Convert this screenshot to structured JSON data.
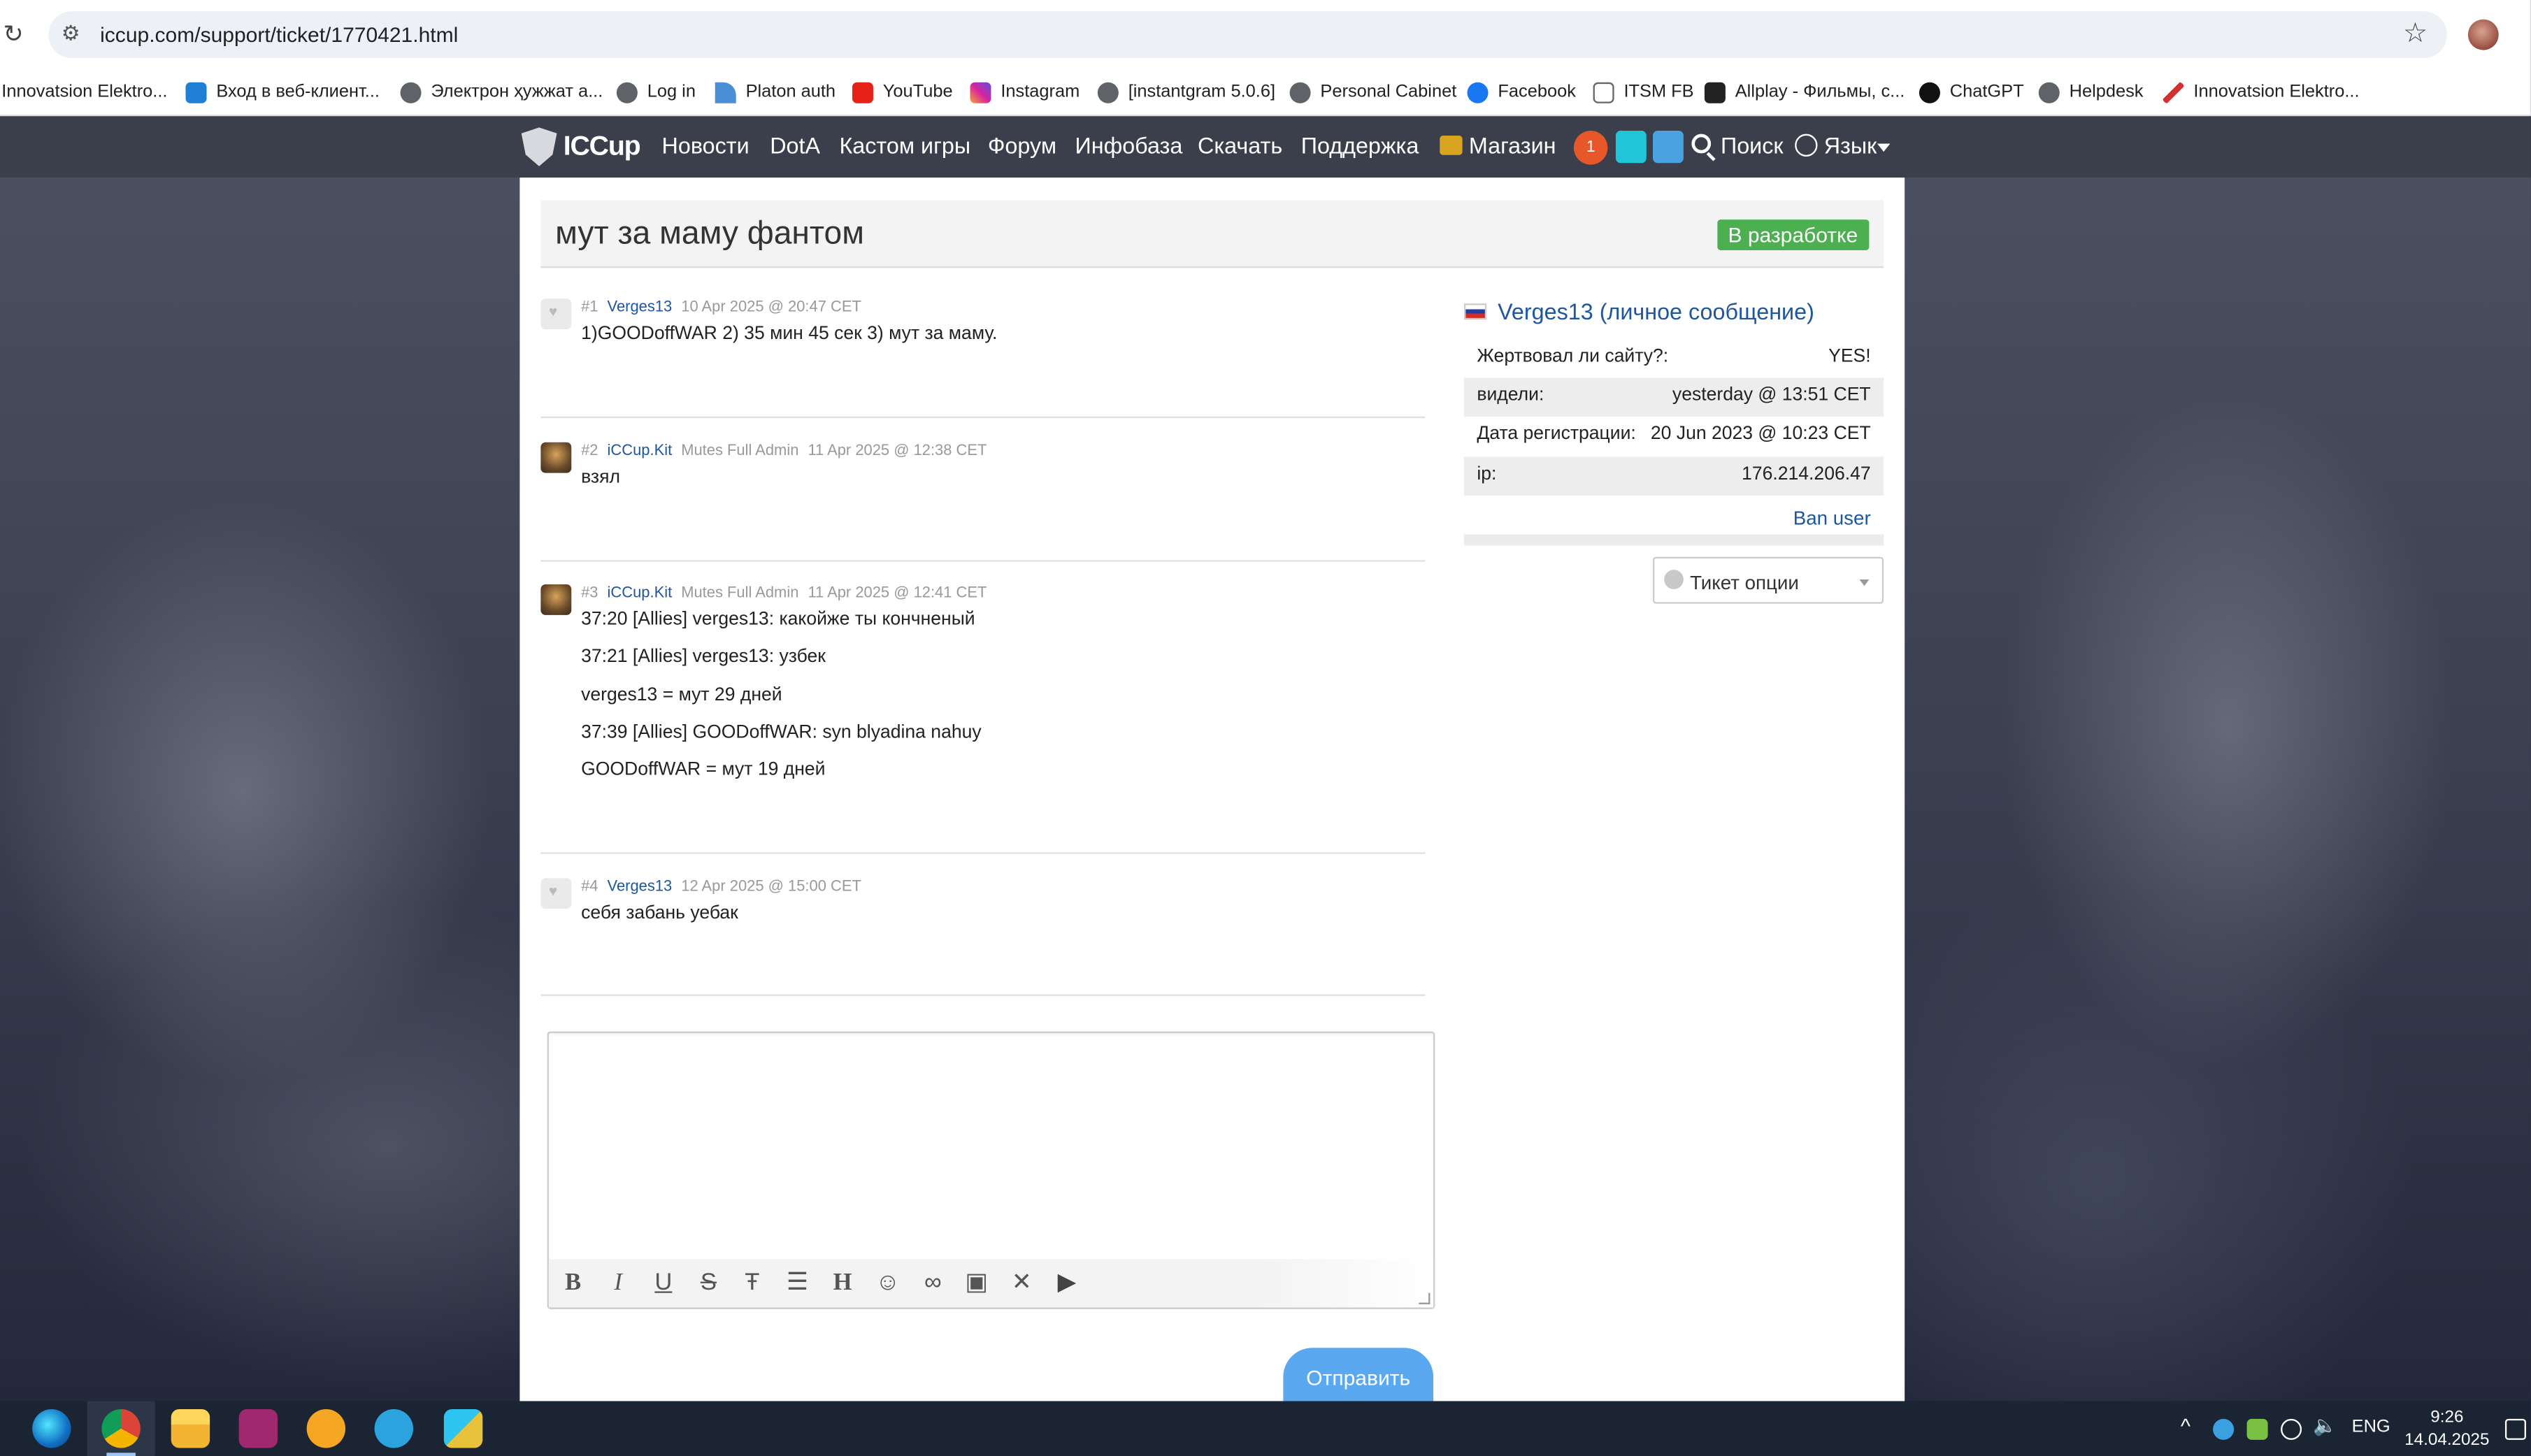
{
  "browser": {
    "url": "iccup.com/support/ticket/1770421.html",
    "bookmarks": [
      {
        "label": "Innovatsion Elektro...",
        "icon": "innovatsion-icon"
      },
      {
        "label": "Вход в веб-клиент...",
        "icon": "zimbra-icon"
      },
      {
        "label": "Электрон ҳужжат а...",
        "icon": "globe-icon"
      },
      {
        "label": "Log in",
        "icon": "globe-icon"
      },
      {
        "label": "Platon auth",
        "icon": "platon-icon"
      },
      {
        "label": "YouTube",
        "icon": "youtube-icon"
      },
      {
        "label": "Instagram",
        "icon": "instagram-icon"
      },
      {
        "label": "[instantgram 5.0.6]",
        "icon": "globe-icon"
      },
      {
        "label": "Personal Cabinet",
        "icon": "globe-icon"
      },
      {
        "label": "Facebook",
        "icon": "facebook-icon"
      },
      {
        "label": "ITSM FB",
        "icon": "document-icon"
      },
      {
        "label": "Allplay - Фильмы, с...",
        "icon": "allplay-icon"
      },
      {
        "label": "ChatGPT",
        "icon": "chatgpt-icon"
      },
      {
        "label": "Helpdesk",
        "icon": "globe-icon"
      },
      {
        "label": "Innovatsion Elektro...",
        "icon": "innovatsion-icon"
      }
    ]
  },
  "site_nav": {
    "logo": "ICCup",
    "items": [
      "Новости",
      "DotA",
      "Кастом игры",
      "Форум",
      "Инфобаза",
      "Скачать",
      "Поддержка"
    ],
    "shop": "Магазин",
    "notifications": "1",
    "search": "Поиск",
    "language": "Язык"
  },
  "ticket": {
    "title": "мут за маму фантом",
    "status": "В разработке",
    "posts": [
      {
        "num": "#1",
        "author": "Verges13",
        "role": "",
        "date": "10 Apr 2025 @ 20:47 CET",
        "lines": [
          "1)GOODoffWAR 2) 35 мин 45 сек 3) мут за маму."
        ]
      },
      {
        "num": "#2",
        "author": "iCCup.Kit",
        "role": "Mutes Full Admin",
        "date": "11 Apr 2025 @ 12:38 CET",
        "lines": [
          "взял"
        ]
      },
      {
        "num": "#3",
        "author": "iCCup.Kit",
        "role": "Mutes Full Admin",
        "date": "11 Apr 2025 @ 12:41 CET",
        "lines": [
          "37:20 [Allies] verges13: какойже ты кончненый",
          "37:21 [Allies] verges13: узбек",
          "verges13 = мут 29 дней",
          "37:39 [Allies] GOODoffWAR: syn blyadina nahuy",
          "GOODoffWAR = мут 19 дней"
        ]
      },
      {
        "num": "#4",
        "author": "Verges13",
        "role": "",
        "date": "12 Apr 2025 @ 15:00 CET",
        "lines": [
          "себя забань уебак"
        ]
      }
    ],
    "submit_label": "Отправить",
    "editor_tools": [
      "bold-icon",
      "italic-icon",
      "underline-icon",
      "strikethrough-icon",
      "text-height-icon",
      "list-icon",
      "heading-icon",
      "emoji-icon",
      "link-icon",
      "image-icon",
      "remove-format-icon",
      "youtube-icon"
    ]
  },
  "user_card": {
    "name": "Verges13",
    "pm_link": "(личное сообщение)",
    "rows": [
      {
        "key": "Жертвовал ли сайту?:",
        "value": "YES!"
      },
      {
        "key": "видели:",
        "value": "yesterday @ 13:51 CET"
      },
      {
        "key": "Дата регистрации:",
        "value": "20 Jun 2023 @ 10:23 CET"
      },
      {
        "key": "ip:",
        "value": "176.214.206.47"
      }
    ],
    "ban_link": "Ban user",
    "ticket_options": "Тикет опции"
  },
  "taskbar": {
    "apps": [
      "edge-icon",
      "chrome-icon",
      "file-explorer-icon",
      "app-icon",
      "calculator-icon",
      "telegram-icon",
      "remote-desktop-icon"
    ],
    "language": "ENG",
    "time": "9:26",
    "date": "14.04.2025"
  },
  "colors": {
    "nav_bg": "#3a3f4b",
    "link": "#1e56a0",
    "status_green": "#4caf50",
    "submit_blue": "#5aa9f0",
    "taskbar": "#1a2433"
  }
}
